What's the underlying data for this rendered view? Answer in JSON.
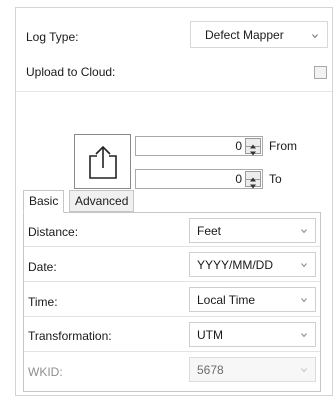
{
  "log_type": {
    "label": "Log Type:",
    "value": "Defect Mapper"
  },
  "upload_cloud": {
    "label": "Upload to Cloud:",
    "checked": false
  },
  "range": {
    "from": {
      "value": "0",
      "label": "From"
    },
    "to": {
      "value": "0",
      "label": "To"
    }
  },
  "tabs": {
    "basic": "Basic",
    "advanced": "Advanced",
    "active": "Basic"
  },
  "basic": {
    "distance": {
      "label": "Distance:",
      "value": "Feet"
    },
    "date": {
      "label": "Date:",
      "value": "YYYY/MM/DD"
    },
    "time": {
      "label": "Time:",
      "value": "Local Time"
    },
    "transformation": {
      "label": "Transformation:",
      "value": "UTM"
    },
    "wkid": {
      "label": "WKID:",
      "value": "5678",
      "disabled": true
    }
  },
  "icons": {
    "upload": "upload-icon",
    "chevron": "chevron-down-icon",
    "spin_up": "arrow-up-icon",
    "spin_down": "arrow-down-icon"
  }
}
